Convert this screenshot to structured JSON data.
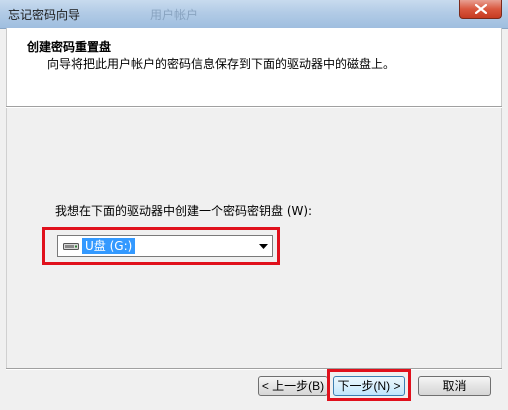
{
  "window": {
    "title": "忘记密码向导",
    "title_ghost": "用户帐户"
  },
  "header": {
    "title": "创建密码重置盘",
    "subtitle": "向导将把此用户帐户的密码信息保存到下面的驱动器中的磁盘上。"
  },
  "content": {
    "prompt_label": "我想在下面的驱动器中创建一个密码密钥盘 (W):",
    "drive_select": {
      "selected": "U盘 (G:)",
      "icon": "usb-drive-icon"
    }
  },
  "buttons": {
    "back": "< 上一步(B)",
    "next": "下一步(N) >",
    "cancel": "取消"
  },
  "colors": {
    "highlight": "#e0101c",
    "selection": "#3399ff",
    "close_button": "#c63b22"
  }
}
